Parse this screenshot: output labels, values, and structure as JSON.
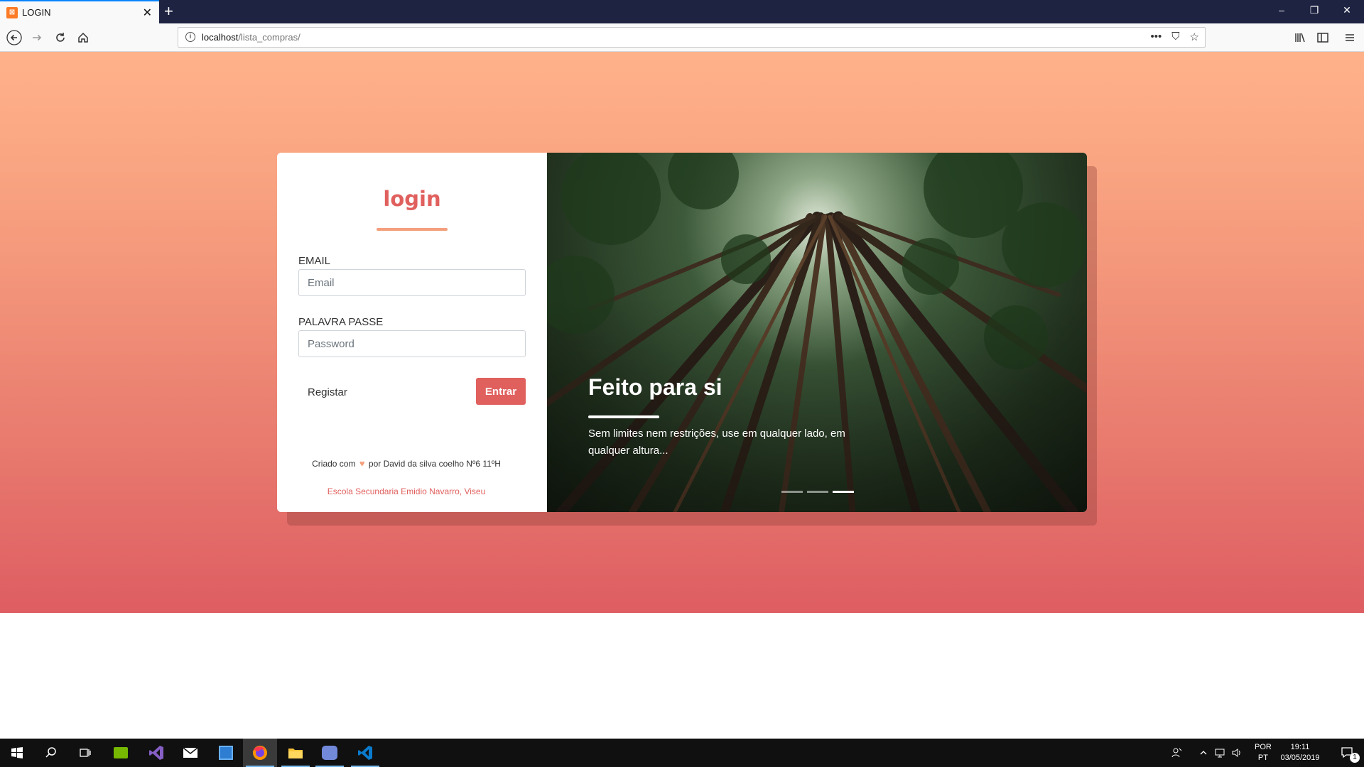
{
  "browser": {
    "tab_title": "LOGIN",
    "tab_favicon": "xampp-icon",
    "url_host": "localhost",
    "url_path": "/lista_compras/"
  },
  "login": {
    "title": "login",
    "email_label": "EMAIL",
    "email_placeholder": "Email",
    "password_label": "PALAVRA PASSE",
    "password_placeholder": "Password",
    "register_label": "Registar",
    "enter_label": "Entrar",
    "credit_prefix": "Criado com",
    "credit_suffix": "por David da silva coelho Nº6 11ºH",
    "school": "Escola Secundaria Emidio Navarro, Viseu"
  },
  "slide": {
    "heading": "Feito para si",
    "text": "Sem limites nem restrições, use em qualquer lado, em qualquer altura...",
    "active_index": 3,
    "count": 3
  },
  "taskbar": {
    "language_top": "POR",
    "language_bottom": "PT",
    "time": "19:11",
    "date": "03/05/2019",
    "notification_count": "1",
    "apps": [
      "nvidia-icon",
      "visual-studio-icon",
      "mail-icon",
      "calculator-icon",
      "firefox-icon",
      "file-explorer-icon",
      "discord-icon",
      "vscode-icon"
    ]
  },
  "colors": {
    "accent": "#e0605e",
    "accent_light": "#f4a07d",
    "gradient_top": "#ffb28a",
    "gradient_bottom": "#de5d62",
    "titlebar": "#1f2342"
  }
}
